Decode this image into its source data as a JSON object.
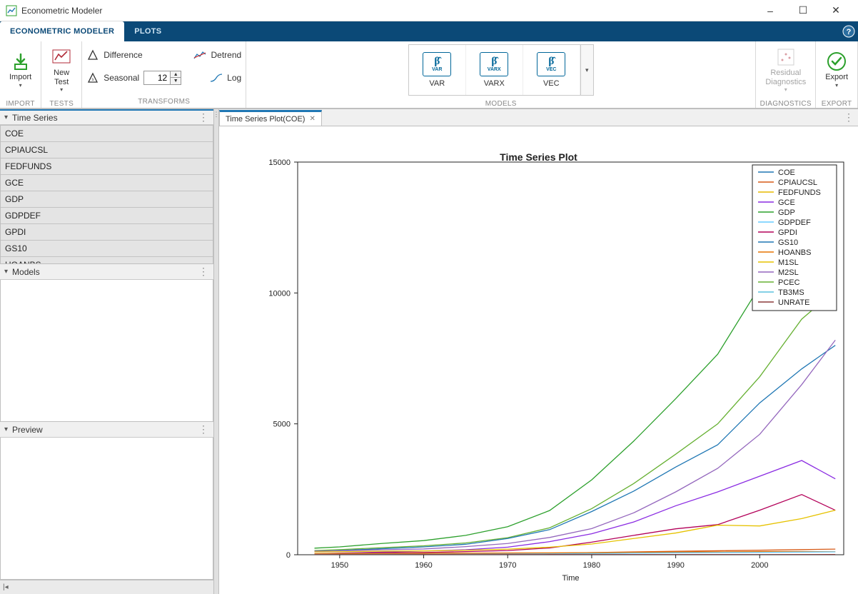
{
  "window": {
    "title": "Econometric Modeler"
  },
  "tabs": {
    "main": "ECONOMETRIC MODELER",
    "plots": "PLOTS"
  },
  "toolstrip": {
    "import": {
      "label": "Import",
      "group": "IMPORT"
    },
    "tests": {
      "newtest": "New\nTest",
      "dropdown": "▾",
      "group": "TESTS"
    },
    "transforms": {
      "difference": "Difference",
      "seasonal": "Seasonal",
      "seasonal_value": "12",
      "detrend": "Detrend",
      "log": "Log",
      "group": "TRANSFORMS"
    },
    "models": {
      "items": [
        {
          "name": "VAR",
          "sub": "VAR"
        },
        {
          "name": "VARX",
          "sub": "VARX"
        },
        {
          "name": "VEC",
          "sub": "VEC"
        }
      ],
      "group": "MODELS"
    },
    "diagnostics": {
      "label": "Residual\nDiagnostics",
      "group": "DIAGNOSTICS"
    },
    "export": {
      "label": "Export",
      "group": "EXPORT"
    }
  },
  "panels": {
    "timeseries": "Time Series",
    "models": "Models",
    "preview": "Preview"
  },
  "series_list": [
    "COE",
    "CPIAUCSL",
    "FEDFUNDS",
    "GCE",
    "GDP",
    "GDPDEF",
    "GPDI",
    "GS10",
    "HOANBS",
    "M1SL",
    "M2SL",
    "PCEC",
    "TB3MS",
    "UNRATE"
  ],
  "doc_tab": "Time Series Plot(COE)",
  "chart_data": {
    "type": "line",
    "title": "Time Series Plot",
    "xlabel": "Time",
    "ylabel": "",
    "xlim": [
      1945,
      2010
    ],
    "ylim": [
      0,
      15000
    ],
    "xticks": [
      1950,
      1960,
      1970,
      1980,
      1990,
      2000
    ],
    "yticks": [
      0,
      5000,
      10000,
      15000
    ],
    "x": [
      1947,
      1950,
      1955,
      1960,
      1965,
      1970,
      1975,
      1980,
      1985,
      1990,
      1995,
      2000,
      2005,
      2009
    ],
    "colors": {
      "COE": "#1f77b4",
      "CPIAUCSL": "#d75a17",
      "FEDFUNDS": "#e6b800",
      "GCE": "#8a2be2",
      "GDP": "#2ca02c",
      "GDPDEF": "#66ccff",
      "GPDI": "#b30059",
      "GS10": "#1f77b4",
      "HOANBS": "#e57300",
      "M1SL": "#e6c200",
      "M2SL": "#9467bd",
      "PCEC": "#66b032",
      "TB3MS": "#5bc0de",
      "UNRATE": "#8b3a3a"
    },
    "series": [
      {
        "name": "GDP",
        "values": [
          250,
          300,
          430,
          540,
          740,
          1070,
          1690,
          2860,
          4340,
          5960,
          7660,
          10250,
          13100,
          14400
        ]
      },
      {
        "name": "PCEC",
        "values": [
          160,
          195,
          270,
          340,
          450,
          650,
          1030,
          1760,
          2720,
          3840,
          5000,
          6800,
          9000,
          10100
        ]
      },
      {
        "name": "COE",
        "values": [
          130,
          160,
          230,
          300,
          400,
          620,
          960,
          1650,
          2430,
          3350,
          4200,
          5800,
          7100,
          8000
        ]
      },
      {
        "name": "M2SL",
        "values": [
          140,
          150,
          190,
          220,
          310,
          430,
          660,
          1000,
          1600,
          2400,
          3300,
          4600,
          6500,
          8200
        ]
      },
      {
        "name": "GCE",
        "values": [
          40,
          60,
          100,
          140,
          190,
          290,
          500,
          800,
          1250,
          1870,
          2400,
          3000,
          3600,
          2900
        ]
      },
      {
        "name": "GPDI",
        "values": [
          35,
          55,
          75,
          85,
          120,
          160,
          260,
          480,
          740,
          990,
          1150,
          1700,
          2300,
          1700
        ]
      },
      {
        "name": "M1SL",
        "values": [
          110,
          115,
          135,
          145,
          170,
          215,
          290,
          410,
          620,
          830,
          1130,
          1100,
          1380,
          1700
        ]
      },
      {
        "name": "CPIAUCSL",
        "values": [
          22,
          24,
          27,
          30,
          32,
          39,
          54,
          82,
          108,
          131,
          152,
          172,
          196,
          215
        ]
      },
      {
        "name": "HOANBS",
        "values": [
          45,
          47,
          52,
          55,
          62,
          68,
          72,
          80,
          90,
          100,
          108,
          117,
          123,
          115
        ]
      },
      {
        "name": "GDPDEF",
        "values": [
          13,
          14,
          16,
          18,
          20,
          25,
          34,
          48,
          62,
          73,
          82,
          89,
          100,
          110
        ]
      },
      {
        "name": "FEDFUNDS",
        "values": [
          1,
          1,
          2,
          3,
          4,
          8,
          6,
          13,
          8,
          8,
          6,
          6,
          3,
          0
        ]
      },
      {
        "name": "GS10",
        "values": [
          2,
          2,
          3,
          4,
          4,
          7,
          8,
          12,
          10,
          8,
          7,
          6,
          4,
          3
        ]
      },
      {
        "name": "TB3MS",
        "values": [
          0,
          1,
          2,
          3,
          4,
          6,
          6,
          11,
          7,
          8,
          5,
          6,
          3,
          0
        ]
      },
      {
        "name": "UNRATE",
        "values": [
          4,
          5,
          4,
          6,
          4,
          5,
          8,
          7,
          7,
          6,
          6,
          4,
          5,
          9
        ]
      }
    ]
  }
}
